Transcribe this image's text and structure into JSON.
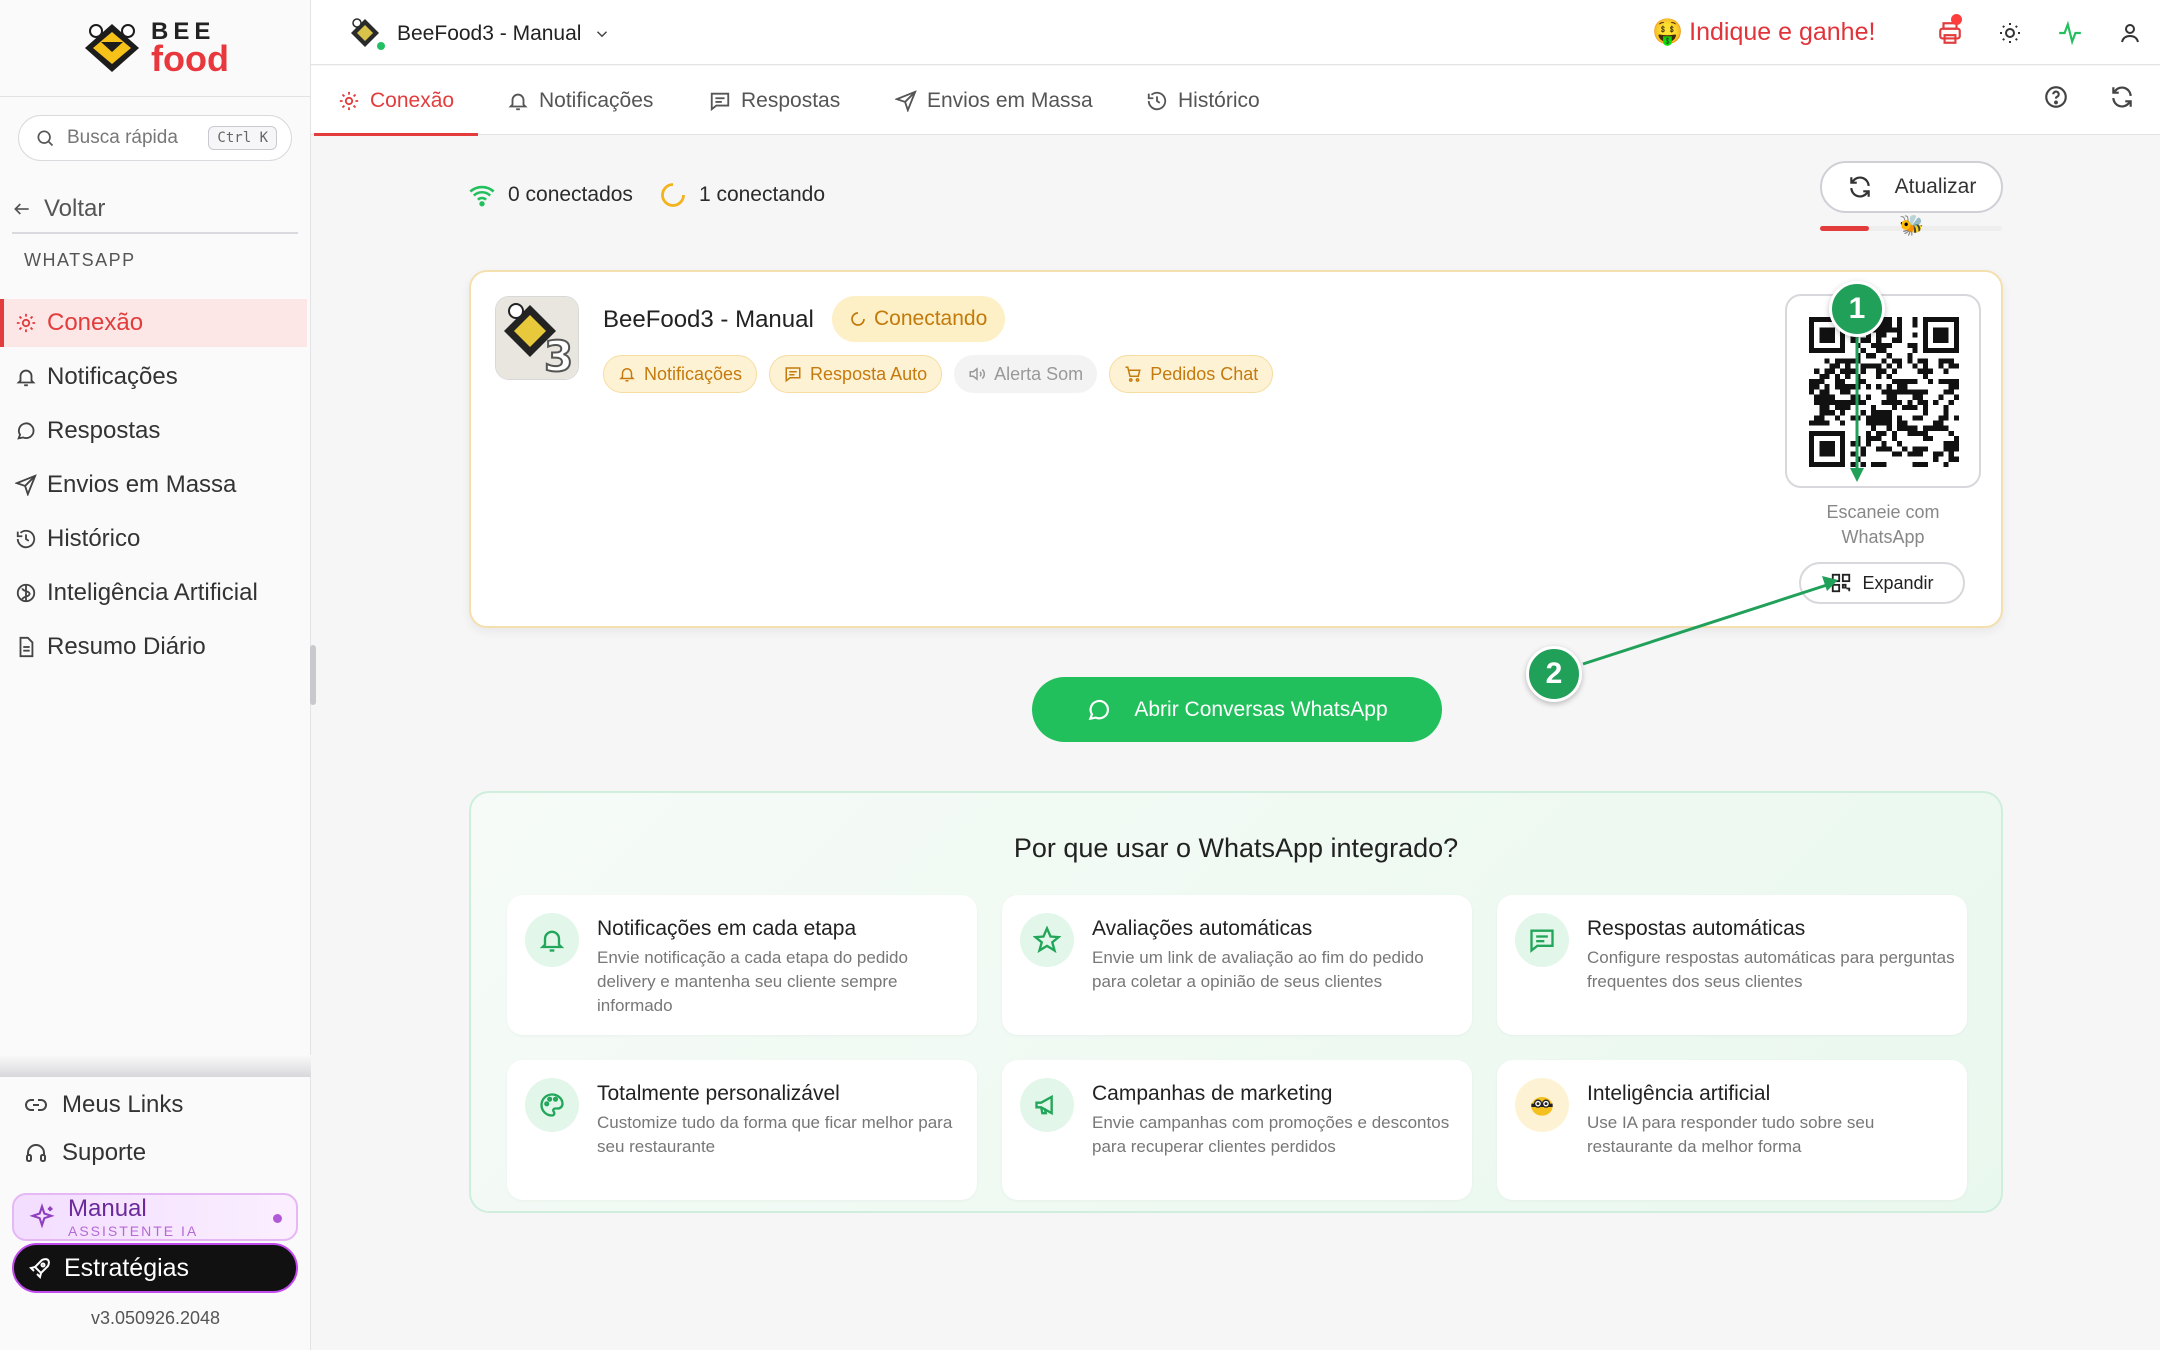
{
  "brand": {
    "line1": "BEE",
    "line2": "food"
  },
  "sidebar": {
    "search_placeholder": "Busca rápida",
    "search_shortcut": "Ctrl K",
    "back_label": "Voltar",
    "section_label": "WHATSAPP",
    "items": [
      {
        "label": "Conexão",
        "icon": "gear-icon",
        "active": true
      },
      {
        "label": "Notificações",
        "icon": "bell-icon"
      },
      {
        "label": "Respostas",
        "icon": "chat-icon"
      },
      {
        "label": "Envios em Massa",
        "icon": "send-icon"
      },
      {
        "label": "Histórico",
        "icon": "history-icon"
      },
      {
        "label": "Inteligência Artificial",
        "icon": "brain-icon"
      },
      {
        "label": "Resumo Diário",
        "icon": "document-icon"
      }
    ],
    "links": [
      {
        "label": "Meus Links",
        "icon": "link-icon"
      },
      {
        "label": "Suporte",
        "icon": "headset-icon"
      }
    ],
    "assistant": {
      "title": "Manual",
      "subtitle": "ASSISTENTE IA"
    },
    "strategies_label": "Estratégias",
    "version": "v3.050926.2048"
  },
  "topbar": {
    "store_name": "BeeFood3 - Manual",
    "referral": "Indique e ganhe!",
    "referral_emoji": "🤑",
    "icons": [
      "printer-icon",
      "sun-icon",
      "activity-icon",
      "user-icon"
    ]
  },
  "tabs": [
    {
      "label": "Conexão",
      "icon": "gear-icon",
      "active": true
    },
    {
      "label": "Notificações",
      "icon": "bell-icon"
    },
    {
      "label": "Respostas",
      "icon": "message-square-icon"
    },
    {
      "label": "Envios em Massa",
      "icon": "send-icon"
    },
    {
      "label": "Histórico",
      "icon": "history-icon"
    }
  ],
  "stats": {
    "connected": "0 conectados",
    "connecting": "1 conectando"
  },
  "update_button": "Atualizar",
  "update_progress": 0.27,
  "connection": {
    "name": "BeeFood3 - Manual",
    "status": "Conectando",
    "chips": [
      {
        "label": "Notificações",
        "icon": "bell-icon",
        "enabled": true
      },
      {
        "label": "Resposta Auto",
        "icon": "message-square-icon",
        "enabled": true
      },
      {
        "label": "Alerta Som",
        "icon": "speaker-icon",
        "enabled": false
      },
      {
        "label": "Pedidos Chat",
        "icon": "cart-icon",
        "enabled": true
      }
    ],
    "qr_caption_line1": "Escaneie com",
    "qr_caption_line2": "WhatsApp",
    "expand_label": "Expandir"
  },
  "annotations": [
    "1",
    "2"
  ],
  "whatsapp_button": "Abrir Conversas WhatsApp",
  "why": {
    "title": "Por que usar o WhatsApp integrado?",
    "features": [
      {
        "title": "Notificações em cada etapa",
        "desc": "Envie notificação a cada etapa do pedido delivery e mantenha seu cliente sempre informado",
        "icon": "bell-icon"
      },
      {
        "title": "Avaliações automáticas",
        "desc": "Envie um link de avaliação ao fim do pedido para coletar a opinião de seus clientes",
        "icon": "star-icon"
      },
      {
        "title": "Respostas automáticas",
        "desc": "Configure respostas automáticas para perguntas frequentes dos seus clientes",
        "icon": "message-square-icon"
      },
      {
        "title": "Totalmente personalizável",
        "desc": "Customize tudo da forma que ficar melhor para seu restaurante",
        "icon": "palette-icon"
      },
      {
        "title": "Campanhas de marketing",
        "desc": "Envie campanhas com promoções e descontos para recuperar clientes perdidos",
        "icon": "megaphone-icon"
      },
      {
        "title": "Inteligência artificial",
        "desc": "Use IA para responder tudo sobre seu restaurante da melhor forma",
        "icon": "bee-icon"
      }
    ]
  },
  "colors": {
    "accent": "#e23c3c",
    "whatsapp": "#22c05c",
    "connecting": "#c27a0a",
    "annotation": "#21a05a"
  }
}
